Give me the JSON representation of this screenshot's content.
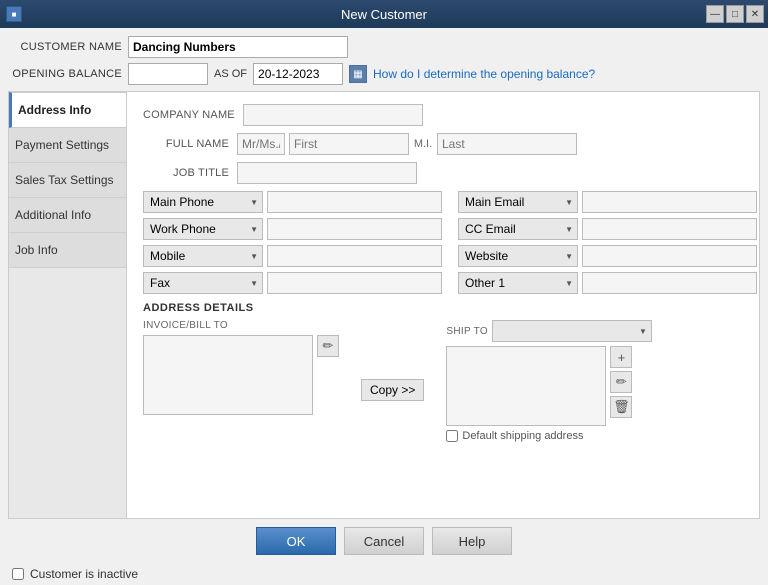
{
  "titleBar": {
    "title": "New Customer",
    "minBtn": "—",
    "maxBtn": "□",
    "closeBtn": "✕"
  },
  "topFields": {
    "customerNameLabel": "CUSTOMER NAME",
    "customerNameValue": "Dancing Numbers",
    "openingBalanceLabel": "OPENING BALANCE",
    "asOfLabel": "AS OF",
    "dateValue": "20-12-2023",
    "helpLinkText": "How do I determine the opening balance?"
  },
  "sidebar": {
    "activeItem": "Address Info",
    "items": [
      "Payment Settings",
      "Sales Tax Settings",
      "Additional Info",
      "Job Info"
    ]
  },
  "form": {
    "companyNameLabel": "COMPANY NAME",
    "fullNameLabel": "FULL NAME",
    "salutationPlaceholder": "Mr/Ms./.",
    "firstNamePlaceholder": "First",
    "miLabel": "M.I.",
    "lastNamePlaceholder": "Last",
    "jobTitleLabel": "JOB TITLE",
    "phoneFields": [
      {
        "label": "Main Phone",
        "value": ""
      },
      {
        "label": "Work Phone",
        "value": ""
      },
      {
        "label": "Mobile",
        "value": ""
      },
      {
        "label": "Fax",
        "value": ""
      }
    ],
    "emailFields": [
      {
        "label": "Main Email",
        "value": ""
      },
      {
        "label": "CC Email",
        "value": ""
      },
      {
        "label": "Website",
        "value": ""
      },
      {
        "label": "Other 1",
        "value": ""
      }
    ],
    "addressDetails": {
      "sectionTitle": "ADDRESS DETAILS",
      "invoiceBillToLabel": "INVOICE/BILL TO",
      "shipToLabel": "SHIP TO",
      "defaultShippingLabel": "Default shipping address",
      "copyBtnLabel": "Copy >>"
    }
  },
  "buttons": {
    "ok": "OK",
    "cancel": "Cancel",
    "help": "Help"
  },
  "footer": {
    "inactiveLabel": "Customer is inactive"
  }
}
